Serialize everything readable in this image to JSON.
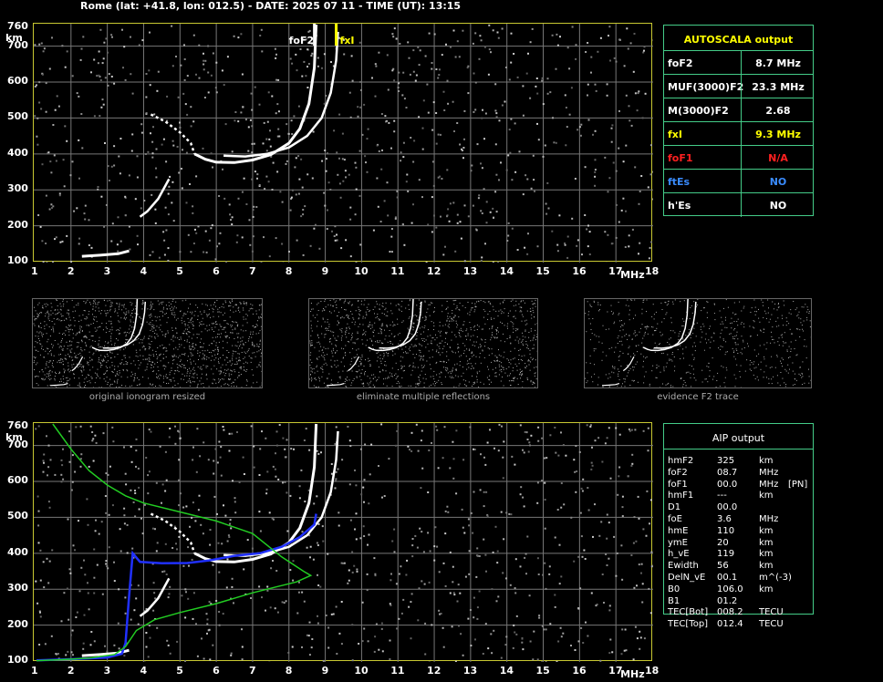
{
  "header": {
    "title": "Rome (lat: +41.8, lon: 012.5) - DATE: 2025 07 11 - TIME (UT): 13:15"
  },
  "axis": {
    "y_ticks": [
      "760",
      "700",
      "600",
      "500",
      "400",
      "300",
      "200",
      "100"
    ],
    "y_unit": "km",
    "x_ticks": [
      "1",
      "2",
      "3",
      "4",
      "5",
      "6",
      "7",
      "8",
      "9",
      "10",
      "11",
      "12",
      "13",
      "14",
      "15",
      "16",
      "17",
      "18"
    ],
    "x_unit": "MHz"
  },
  "markers": {
    "fof2": "foF2",
    "fxi": "fxI"
  },
  "colors": {
    "frame": "#c8c832",
    "panel": "#44cc88",
    "fxi": "#ffff00",
    "fof1": "#ff2020",
    "ftes": "#3a8cff",
    "profile": "#22cc22",
    "trace_blue": "#2030ff"
  },
  "autoscala": {
    "title": "AUTOSCALA output",
    "rows": [
      {
        "key": "foF2",
        "value": "8.7 MHz",
        "color": "#ffffff"
      },
      {
        "key": "MUF(3000)F2",
        "value": "23.3 MHz",
        "color": "#ffffff"
      },
      {
        "key": "M(3000)F2",
        "value": "2.68",
        "color": "#ffffff"
      },
      {
        "key": "fxI",
        "value": "9.3 MHz",
        "color": "#ffff00"
      },
      {
        "key": "foF1",
        "value": "N/A",
        "color": "#ff2020"
      },
      {
        "key": "ftEs",
        "value": "NO",
        "color": "#3a8cff"
      },
      {
        "key": "h'Es",
        "value": "NO",
        "color": "#ffffff"
      }
    ]
  },
  "thumbnails": [
    {
      "caption": "original ionogram resized"
    },
    {
      "caption": "eliminate multiple reflections"
    },
    {
      "caption": "evidence F2 trace"
    }
  ],
  "aip": {
    "title": "AIP output",
    "rows": [
      {
        "k": "hmF2",
        "v": "325",
        "u": "km",
        "x": ""
      },
      {
        "k": "foF2",
        "v": "08.7",
        "u": "MHz",
        "x": ""
      },
      {
        "k": "foF1",
        "v": "00.0",
        "u": "MHz",
        "x": "[PN]"
      },
      {
        "k": "hmF1",
        "v": "---",
        "u": "km",
        "x": ""
      },
      {
        "k": "D1",
        "v": "00.0",
        "u": "",
        "x": ""
      },
      {
        "k": "foE",
        "v": "3.6",
        "u": "MHz",
        "x": ""
      },
      {
        "k": "hmE",
        "v": "110",
        "u": "km",
        "x": ""
      },
      {
        "k": "ymE",
        "v": "20",
        "u": "km",
        "x": ""
      },
      {
        "k": "h_vE",
        "v": "119",
        "u": "km",
        "x": ""
      },
      {
        "k": "Ewidth",
        "v": "56",
        "u": "km",
        "x": ""
      },
      {
        "k": "DelN_vE",
        "v": "00.1",
        "u": "m^(-3)",
        "x": ""
      },
      {
        "k": "B0",
        "v": "106.0",
        "u": "km",
        "x": ""
      },
      {
        "k": "B1",
        "v": "01.2",
        "u": "",
        "x": ""
      },
      {
        "k": "TEC[Bot]",
        "v": "008.2",
        "u": "TECU",
        "x": ""
      },
      {
        "k": "TEC[Top]",
        "v": "012.4",
        "u": "TECU",
        "x": ""
      }
    ]
  }
}
